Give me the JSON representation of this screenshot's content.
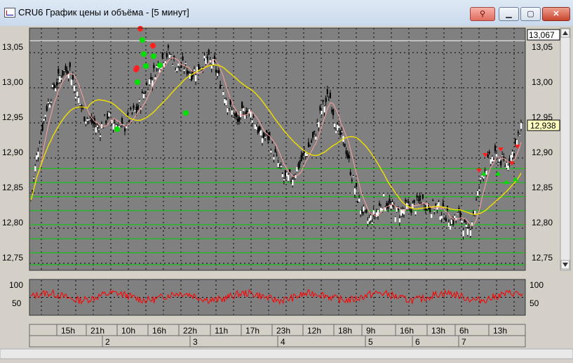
{
  "window": {
    "title": "CRU6 График цены и объёма - [5 минут]",
    "pin_icon": "pin-icon",
    "min_icon": "minimize-icon",
    "max_icon": "maximize-icon",
    "close_icon": "close-icon"
  },
  "price_panel": {
    "y_ticks": [
      "13,05",
      "13,00",
      "12,95",
      "12,90",
      "12,85",
      "12,80",
      "12,75"
    ],
    "top_price_label": "13,067",
    "last_price_label": "12,938",
    "colors": {
      "background": "#808080",
      "candles": "#000000",
      "ma_fast": "#ffb0b0",
      "ma_slow": "#ffff00",
      "levels": "#00dd00",
      "grid": "#000000"
    }
  },
  "oscillator_panel": {
    "y_ticks": [
      "100",
      "50"
    ],
    "colors": {
      "line": "#ff0000",
      "background": "#808080"
    }
  },
  "time_axis": {
    "hours": [
      "15h",
      "21h",
      "10h",
      "16h",
      "22h",
      "11h",
      "17h",
      "23h",
      "12h",
      "18h",
      "9h",
      "16h",
      "13h",
      "6h",
      "13h"
    ],
    "days": [
      "2",
      "3",
      "4",
      "5",
      "6",
      "7"
    ]
  },
  "chart_data": {
    "type": "candlestick",
    "price_range": [
      12.74,
      13.085
    ],
    "levels": [
      12.885,
      12.865,
      12.845,
      12.825,
      12.805,
      12.785,
      12.765,
      12.748
    ],
    "close_series": [
      12.84,
      12.92,
      12.97,
      13.0,
      13.02,
      13.03,
      12.99,
      12.96,
      12.95,
      12.94,
      12.96,
      12.95,
      12.94,
      12.96,
      12.97,
      13.0,
      13.02,
      13.04,
      13.05,
      13.03,
      13.03,
      13.02,
      13.03,
      13.04,
      13.03,
      13.0,
      12.97,
      12.95,
      12.97,
      12.96,
      12.93,
      12.93,
      12.9,
      12.87,
      12.87,
      12.89,
      12.91,
      12.93,
      12.97,
      12.99,
      12.94,
      12.92,
      12.87,
      12.83,
      12.81,
      12.82,
      12.84,
      12.83,
      12.82,
      12.83,
      12.83,
      12.84,
      12.83,
      12.83,
      12.82,
      12.81,
      12.82,
      12.79,
      12.83,
      12.88,
      12.9,
      12.9,
      12.89,
      12.91,
      12.94
    ],
    "oscillator_range": [
      0,
      100
    ]
  }
}
